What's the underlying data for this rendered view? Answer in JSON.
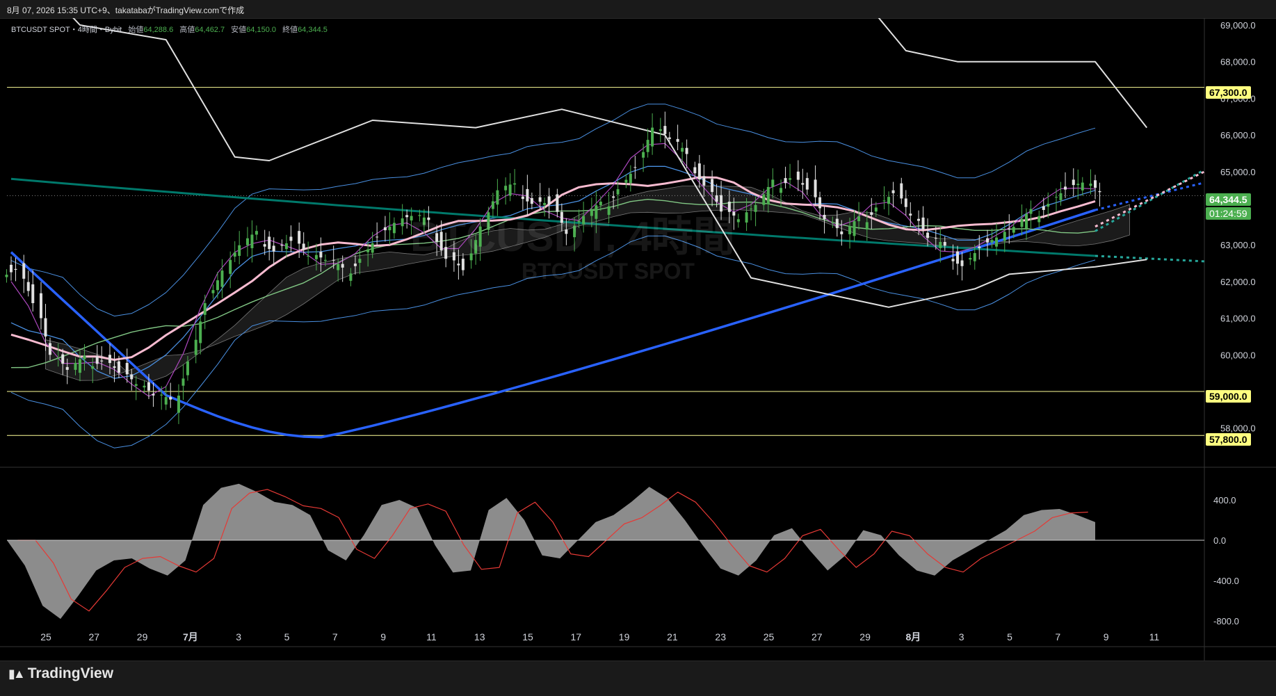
{
  "header": {
    "credit": "8月 07, 2026 15:35 UTC+9、takatabaがTradingView.comで作成"
  },
  "legend": {
    "symbol": "BTCUSDT SPOT・4時間・Bybit",
    "open_label": "始値",
    "open": "64,288.6",
    "high_label": "高値",
    "high": "64,462.7",
    "low_label": "安値",
    "low": "64,150.0",
    "close_label": "終値",
    "close": "64,344.5"
  },
  "watermark": {
    "title": "BTCUSDT, 4時間",
    "subtitle": "BTCUSDT SPOT"
  },
  "price_axis": {
    "ticks": [
      "69,000.0",
      "68,000.0",
      "67,000.0",
      "66,000.0",
      "65,000.0",
      "63,000.0",
      "62,000.0",
      "61,000.0",
      "60,000.0",
      "58,000.0"
    ]
  },
  "osc_axis": {
    "ticks": [
      "400.0",
      "0.0",
      "-400.0",
      "-800.0"
    ]
  },
  "time_axis": {
    "ticks": [
      "25",
      "27",
      "29",
      "7月",
      "3",
      "5",
      "7",
      "9",
      "11",
      "13",
      "15",
      "17",
      "19",
      "21",
      "23",
      "25",
      "27",
      "29",
      "8月",
      "3",
      "5",
      "7",
      "9",
      "11"
    ]
  },
  "price_tags": {
    "level_top": "67,300.0",
    "level_mid": "59,000.0",
    "level_low": "57,800.0",
    "current": "64,344.5",
    "countdown": "01:24:59"
  },
  "colors": {
    "up": "#4caf50",
    "down": "#e0e0e0",
    "bb": "#4a90e2",
    "ema_pink": "#f8bbd0",
    "ma_blue": "#2962ff",
    "ma_teal": "#00796b",
    "ma_green": "#81c784",
    "hull": "#e0e0e0",
    "level": "#ffff99",
    "tag_level": "#ffff80",
    "tag_price": "#4caf50"
  },
  "brand": {
    "name": "TradingView",
    "icon": "tradingview-logo-icon"
  },
  "chart_data": {
    "type": "candlestick",
    "title": "BTCUSDT SPOT",
    "timeframe": "4時間",
    "exchange": "Bybit",
    "ylim": [
      57000,
      69300
    ],
    "horizontal_levels": [
      67300,
      59000,
      57800
    ],
    "last_close": 64344.5,
    "price_path": [
      [
        0,
        62500
      ],
      [
        1,
        61500
      ],
      [
        2,
        60000
      ],
      [
        3,
        59500
      ],
      [
        4,
        59800
      ],
      [
        5,
        60000
      ],
      [
        6,
        59600
      ],
      [
        7,
        59200
      ],
      [
        8,
        58800
      ],
      [
        9,
        58600
      ],
      [
        10,
        60000
      ],
      [
        11,
        61500
      ],
      [
        12,
        62300
      ],
      [
        13,
        62900
      ],
      [
        14,
        63200
      ],
      [
        15,
        63000
      ],
      [
        16,
        63200
      ],
      [
        17,
        62700
      ],
      [
        18,
        62500
      ],
      [
        19,
        62200
      ],
      [
        20,
        62800
      ],
      [
        21,
        63300
      ],
      [
        22,
        63600
      ],
      [
        23,
        63700
      ],
      [
        24,
        63500
      ],
      [
        25,
        62800
      ],
      [
        26,
        62400
      ],
      [
        27,
        63500
      ],
      [
        28,
        64400
      ],
      [
        29,
        64500
      ],
      [
        30,
        64300
      ],
      [
        31,
        64200
      ],
      [
        32,
        63300
      ],
      [
        33,
        63700
      ],
      [
        34,
        64000
      ],
      [
        35,
        64700
      ],
      [
        36,
        65200
      ],
      [
        37,
        66200
      ],
      [
        38,
        65800
      ],
      [
        39,
        65300
      ],
      [
        40,
        64800
      ],
      [
        41,
        64000
      ],
      [
        42,
        63700
      ],
      [
        43,
        64000
      ],
      [
        44,
        64600
      ],
      [
        45,
        65000
      ],
      [
        46,
        64600
      ],
      [
        47,
        63700
      ],
      [
        48,
        63200
      ],
      [
        49,
        63600
      ],
      [
        50,
        64200
      ],
      [
        51,
        64500
      ],
      [
        52,
        63800
      ],
      [
        53,
        63100
      ],
      [
        54,
        62800
      ],
      [
        55,
        62600
      ],
      [
        56,
        63000
      ],
      [
        57,
        63200
      ],
      [
        58,
        63400
      ],
      [
        59,
        63800
      ],
      [
        60,
        64300
      ],
      [
        61,
        64600
      ],
      [
        62,
        64700
      ],
      [
        63,
        64350
      ]
    ],
    "oscillator": {
      "type": "area",
      "ylim": [
        -900,
        600
      ],
      "values": [
        [
          0,
          0
        ],
        [
          1,
          -250
        ],
        [
          2,
          -650
        ],
        [
          3,
          -780
        ],
        [
          4,
          -550
        ],
        [
          5,
          -300
        ],
        [
          6,
          -200
        ],
        [
          7,
          -180
        ],
        [
          8,
          -280
        ],
        [
          9,
          -350
        ],
        [
          10,
          -200
        ],
        [
          11,
          350
        ],
        [
          12,
          520
        ],
        [
          13,
          560
        ],
        [
          14,
          480
        ],
        [
          15,
          380
        ],
        [
          16,
          350
        ],
        [
          17,
          250
        ],
        [
          18,
          -100
        ],
        [
          19,
          -200
        ],
        [
          20,
          50
        ],
        [
          21,
          350
        ],
        [
          22,
          400
        ],
        [
          23,
          320
        ],
        [
          24,
          -50
        ],
        [
          25,
          -320
        ],
        [
          26,
          -300
        ],
        [
          27,
          300
        ],
        [
          28,
          420
        ],
        [
          29,
          200
        ],
        [
          30,
          -150
        ],
        [
          31,
          -180
        ],
        [
          32,
          0
        ],
        [
          33,
          180
        ],
        [
          34,
          250
        ],
        [
          35,
          380
        ],
        [
          36,
          530
        ],
        [
          37,
          420
        ],
        [
          38,
          200
        ],
        [
          39,
          -50
        ],
        [
          40,
          -280
        ],
        [
          41,
          -350
        ],
        [
          42,
          -200
        ],
        [
          43,
          50
        ],
        [
          44,
          120
        ],
        [
          45,
          -100
        ],
        [
          46,
          -300
        ],
        [
          47,
          -150
        ],
        [
          48,
          100
        ],
        [
          49,
          50
        ],
        [
          50,
          -150
        ],
        [
          51,
          -300
        ],
        [
          52,
          -350
        ],
        [
          53,
          -200
        ],
        [
          54,
          -100
        ],
        [
          55,
          0
        ],
        [
          56,
          100
        ],
        [
          57,
          250
        ],
        [
          58,
          300
        ],
        [
          59,
          310
        ],
        [
          60,
          250
        ],
        [
          61,
          180
        ]
      ]
    }
  }
}
